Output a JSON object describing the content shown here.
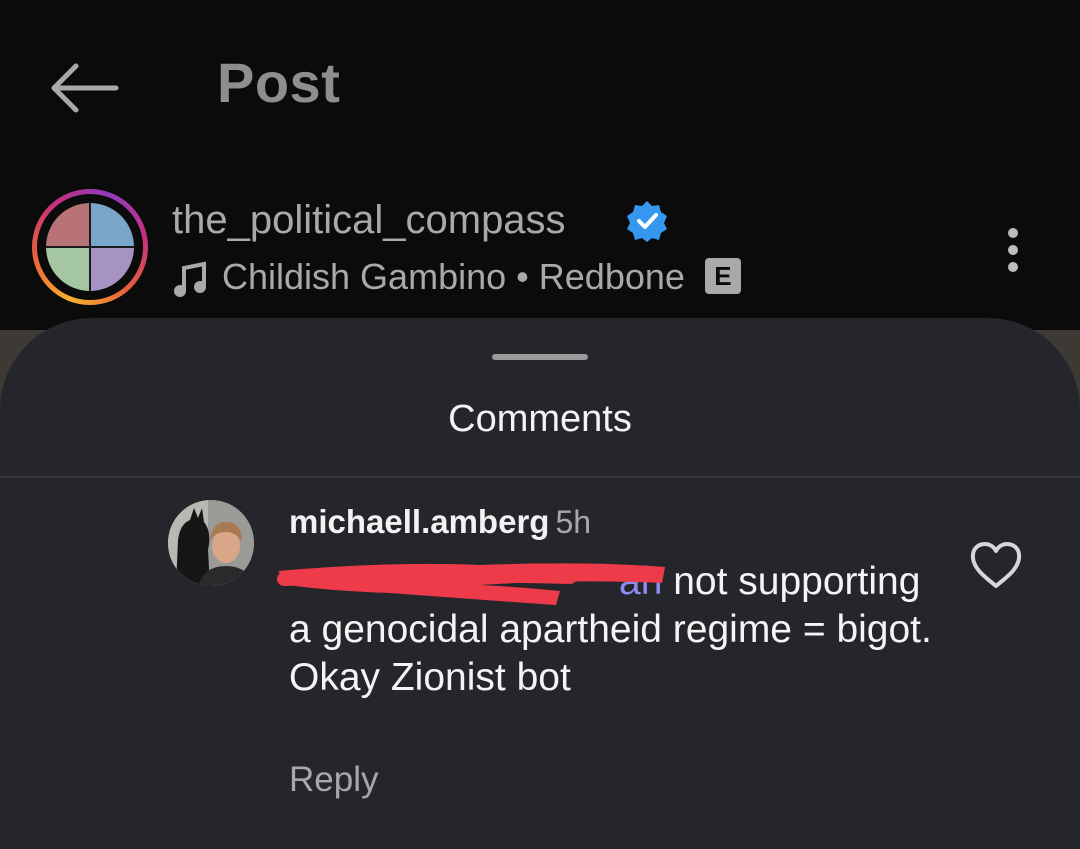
{
  "header": {
    "title": "Post",
    "back_icon": "arrow-left-icon"
  },
  "post": {
    "author": "the_political_compass",
    "verified": true,
    "audio_artist": "Childish Gambino",
    "audio_separator": "•",
    "audio_track": "Redbone",
    "explicit_label": "E"
  },
  "comments_sheet": {
    "title": "Comments",
    "comment": {
      "username": "michaell.amberg",
      "time": "5h",
      "mention_visible_fragment": "ah",
      "text": " not supporting a genocidal apartheid regime = bigot. Okay Zionist bot",
      "reply_label": "Reply"
    }
  },
  "colors": {
    "background": "#0a0a0b",
    "sheet": "#25262b",
    "mention": "#8d8cf0",
    "verified": "#3797f0",
    "redaction": "#ee3b4a"
  }
}
